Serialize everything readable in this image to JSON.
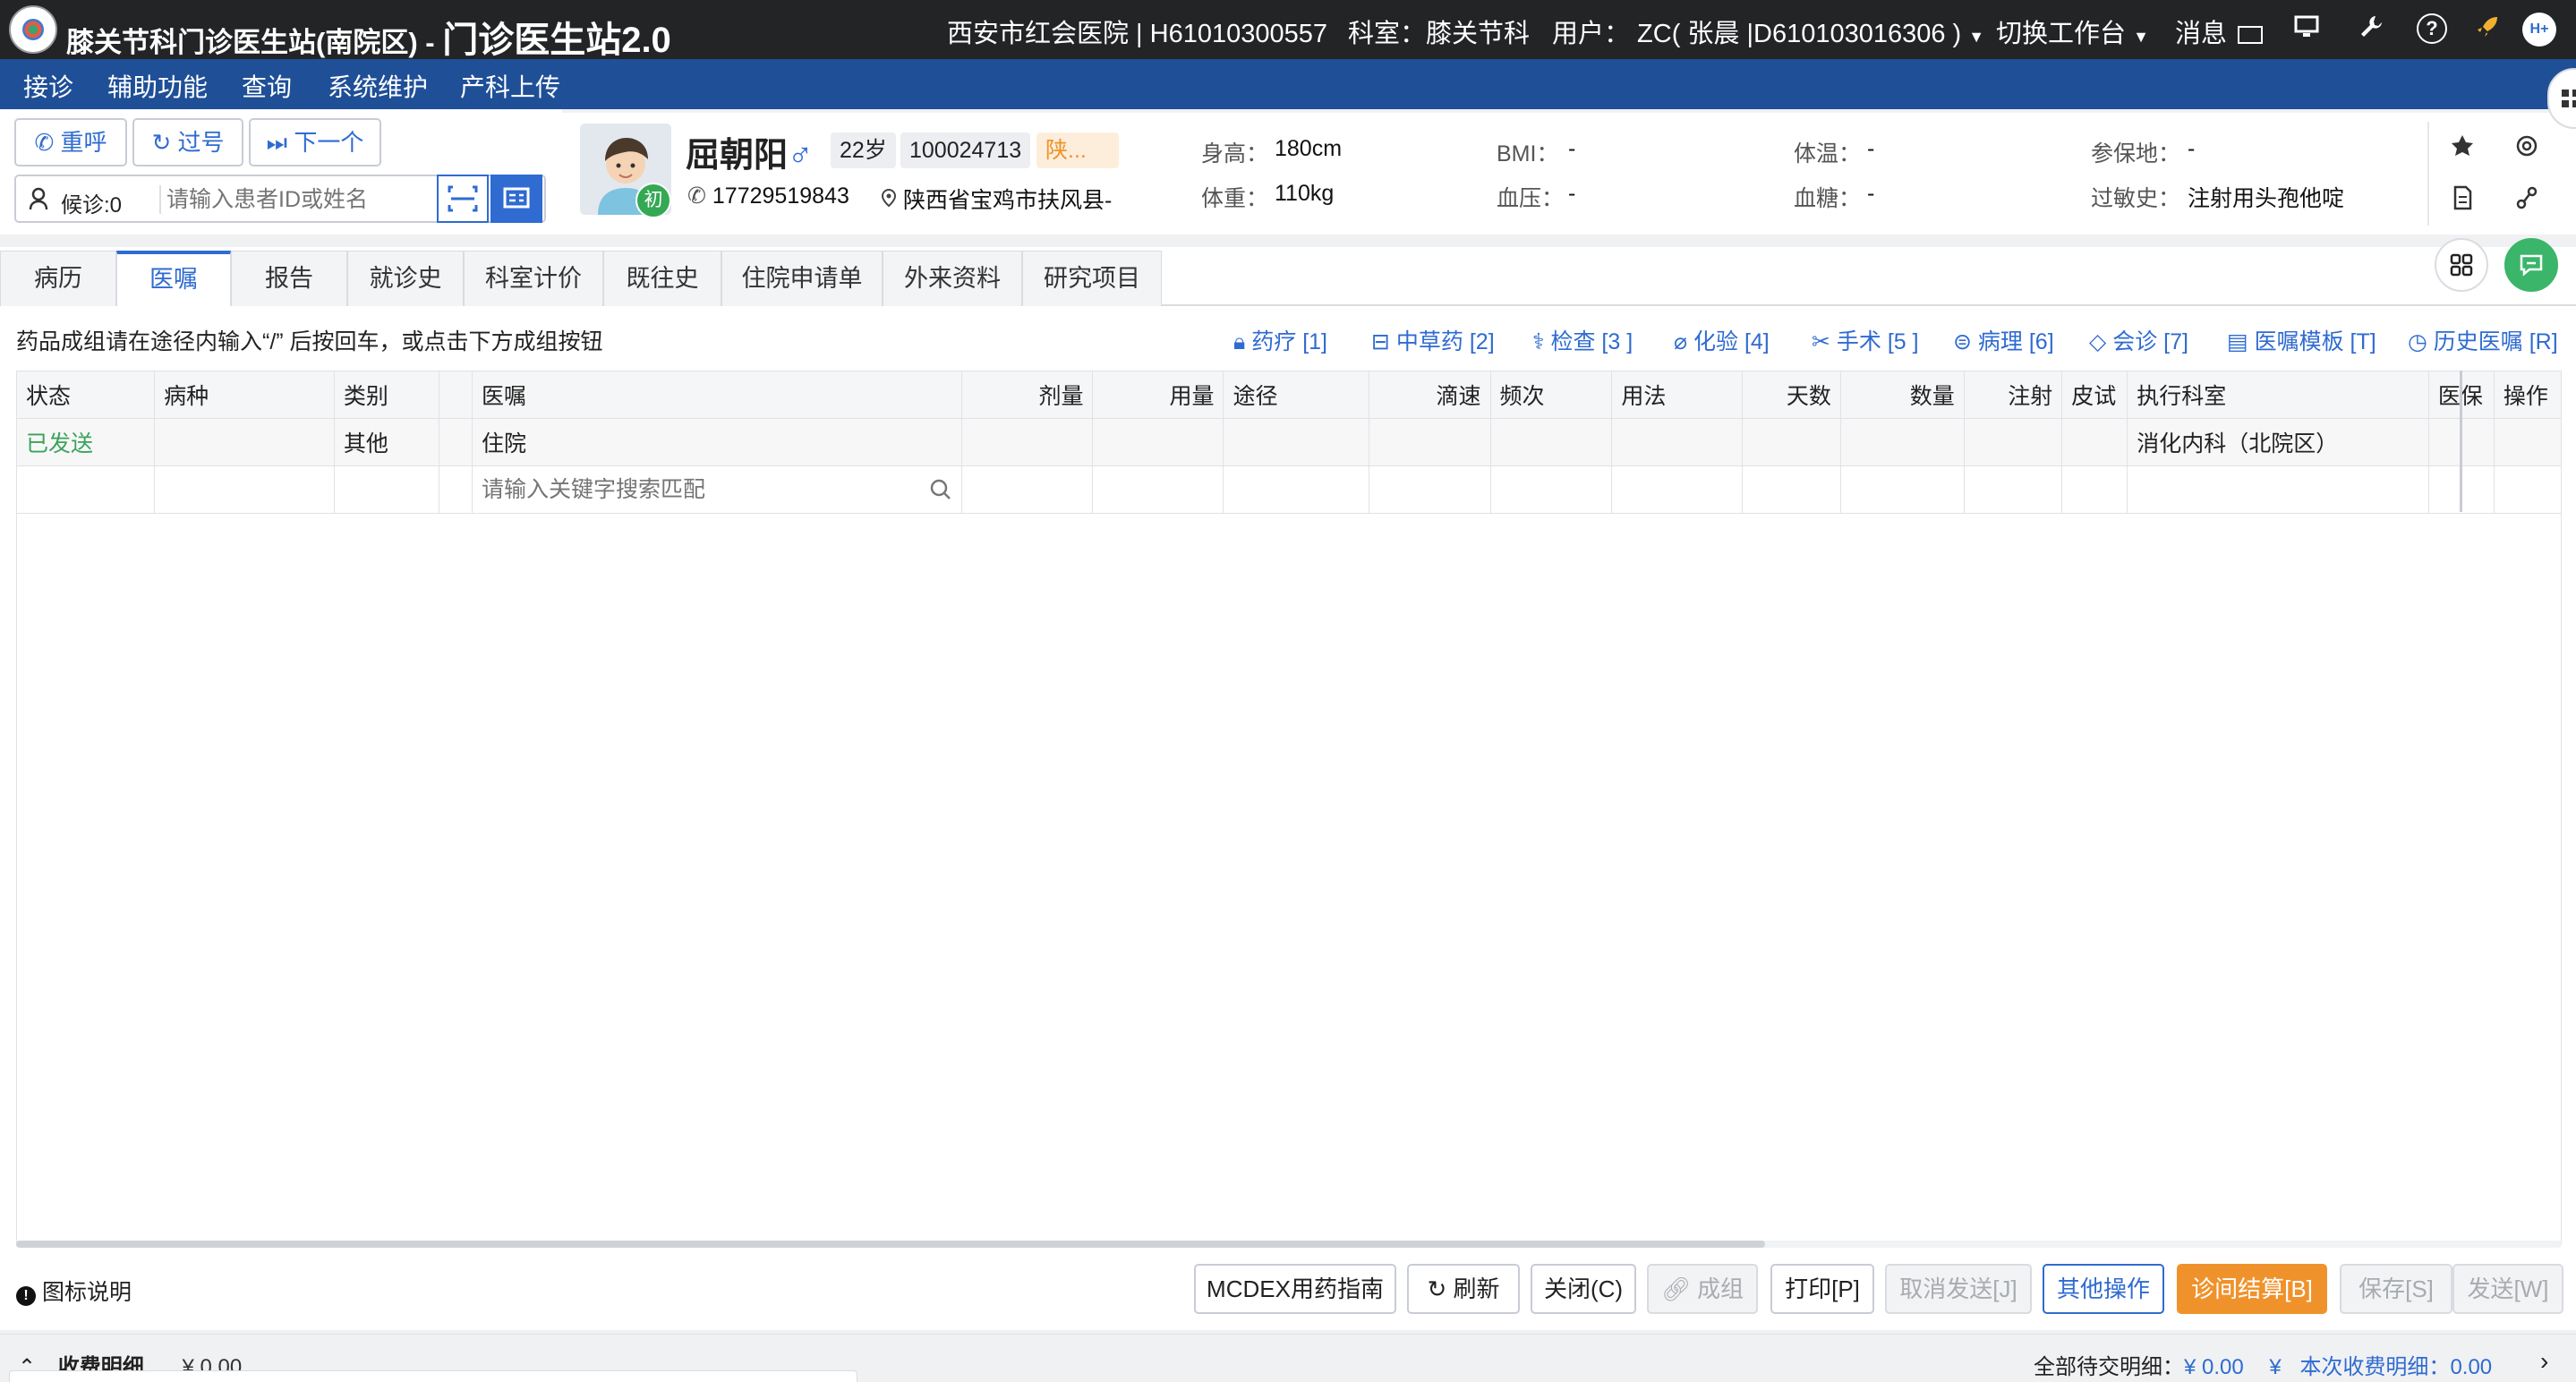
{
  "titlebar": {
    "app_name": "膝关节科门诊医生站(南院区) - ",
    "app_version": "门诊医生站2.0",
    "hospital": "西安市红会医院 | H61010300557",
    "department": "科室：膝关节科",
    "user": "用户： ZC( 张晨 |D610103016306 )",
    "switch_workbench": "切换工作台",
    "messages": "消息",
    "help": "?",
    "avatar_text": "H+"
  },
  "menu": [
    "接诊",
    "辅助功能",
    "查询",
    "系统维护",
    "产科上传"
  ],
  "queue": {
    "recall": "重呼",
    "skip": "过号",
    "next": "下一个",
    "waiting": "候诊:0",
    "search_placeholder": "请输入患者ID或姓名"
  },
  "patient": {
    "name": "屈朝阳",
    "gender_symbol": "♂",
    "age": "22岁",
    "id": "100024713",
    "insurance_tag": "陕...",
    "first_visit": "初",
    "phone": "17729519843",
    "address": "陕西省宝鸡市扶风县-",
    "height_label": "身高：",
    "height": "180cm",
    "weight_label": "体重：",
    "weight": "110kg",
    "bmi_label": "BMI：",
    "bmi": "-",
    "bp_label": "血压：",
    "bp": "-",
    "temp_label": "体温：",
    "temp": "-",
    "glucose_label": "血糖：",
    "glucose": "-",
    "insured_label": "参保地：",
    "insured": "-",
    "allergy_label": "过敏史：",
    "allergy": "注射用头孢他啶"
  },
  "tabs": [
    "病历",
    "医嘱",
    "报告",
    "就诊史",
    "科室计价",
    "既往史",
    "住院申请单",
    "外来资料",
    "研究项目"
  ],
  "orders": {
    "hint": "药品成组请在途径内输入“/” 后按回车，或点击下方成组按钮",
    "quick_links": [
      "药疗 [1]",
      "中草药 [2]",
      "检查 [3 ]",
      "化验 [4]",
      "手术 [5 ]",
      "病理 [6]",
      "会诊 [7]",
      "医嘱模板 [T]",
      "历史医嘱 [R]"
    ],
    "columns": [
      "状态",
      "病种",
      "类别",
      "",
      "医嘱",
      "剂量",
      "用量",
      "途径",
      "滴速",
      "频次",
      "用法",
      "天数",
      "数量",
      "注射",
      "皮试",
      "执行科室",
      "医保",
      "操作"
    ],
    "rows": [
      {
        "status": "已发送",
        "disease": "",
        "category": "其他",
        "order": "住院",
        "dept": "消化内科（北院区）"
      }
    ],
    "new_row_placeholder": "请输入关键字搜索匹配"
  },
  "actions": {
    "legend": "图标说明",
    "buttons": [
      "MCDEX用药指南",
      "刷新",
      "关闭(C)",
      "成组",
      "打印[P]",
      "取消发送[J]",
      "其他操作",
      "诊间结算[B]",
      "保存[S]",
      "发送[W]"
    ]
  },
  "footer": {
    "fee_detail": "收费明细",
    "fee_amount": "¥ 0.00",
    "pending_label": "全部待交明细：",
    "pending_amount": "¥ 0.00",
    "current_label": "本次收费明细：",
    "current_amount": "0.00",
    "current_currency": "¥"
  },
  "colors": {
    "titlebar": "#222426",
    "menubar": "#1f4f97",
    "accent": "#2f6bd1",
    "sent": "#3aa35a",
    "settle": "#f0922b"
  }
}
